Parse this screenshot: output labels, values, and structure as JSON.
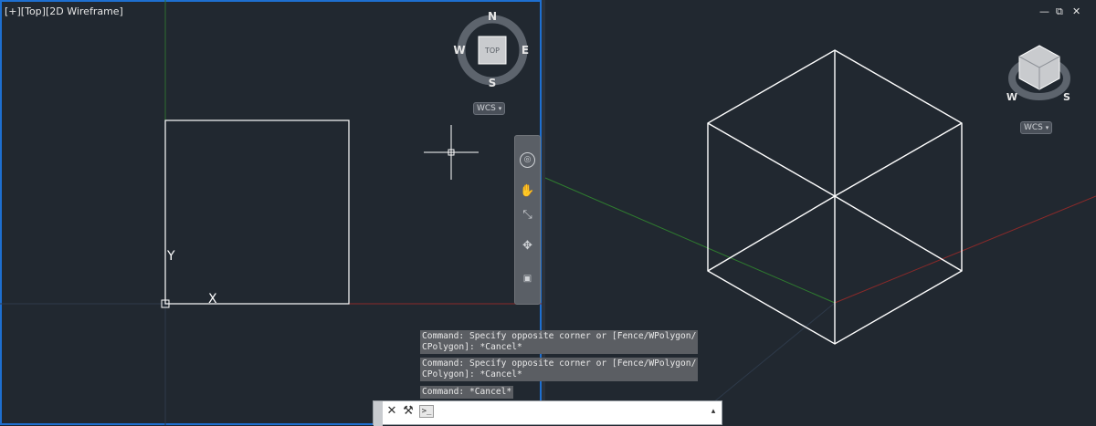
{
  "viewports": {
    "left": {
      "label": "[+][Top][2D Wireframe]"
    },
    "right": {
      "window_controls": {
        "minimize": "—",
        "restore": "⧉",
        "close": "✕"
      }
    }
  },
  "viewcube": {
    "left": {
      "north": "N",
      "south": "S",
      "east": "E",
      "west": "W",
      "face": "TOP",
      "wcs": "WCS"
    },
    "right": {
      "west": "W",
      "south": "S",
      "wcs": "WCS"
    }
  },
  "ucs": {
    "y_label": "Y",
    "x_label": "X"
  },
  "navbar": {
    "icons": [
      "steering-wheel-icon",
      "pan-hand-icon",
      "zoom-extents-icon",
      "orbit-icon",
      "showmotion-icon"
    ]
  },
  "command_history": [
    "Command: Specify opposite corner or [Fence/WPolygon/\nCPolygon]: *Cancel*",
    "Command: Specify opposite corner or [Fence/WPolygon/\nCPolygon]: *Cancel*",
    "Command: *Cancel*"
  ],
  "command_bar": {
    "close_icon": "✕",
    "customize_icon": "⚒",
    "prompt_icon": ">_",
    "value": "",
    "scroll_icon": "▴"
  },
  "colors": {
    "viewport_bg": "#212830",
    "active_border": "#1e6fd0",
    "x_axis": "#9b2a2a",
    "y_axis": "#2f7d2f"
  }
}
